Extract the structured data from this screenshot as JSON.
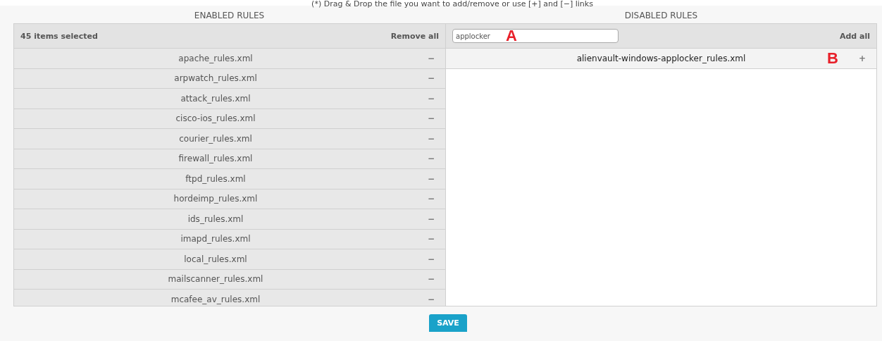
{
  "note": "(*) Drag & Drop the file you want to add/remove or use [+] and [−] links",
  "enabled": {
    "title": "ENABLED RULES",
    "count": "45 items selected",
    "action": "Remove all",
    "items": [
      {
        "name": "apache_rules.xml",
        "control": "−"
      },
      {
        "name": "arpwatch_rules.xml",
        "control": "−"
      },
      {
        "name": "attack_rules.xml",
        "control": "−"
      },
      {
        "name": "cisco-ios_rules.xml",
        "control": "−"
      },
      {
        "name": "courier_rules.xml",
        "control": "−"
      },
      {
        "name": "firewall_rules.xml",
        "control": "−"
      },
      {
        "name": "ftpd_rules.xml",
        "control": "−"
      },
      {
        "name": "hordeimp_rules.xml",
        "control": "−"
      },
      {
        "name": "ids_rules.xml",
        "control": "−"
      },
      {
        "name": "imapd_rules.xml",
        "control": "−"
      },
      {
        "name": "local_rules.xml",
        "control": "−"
      },
      {
        "name": "mailscanner_rules.xml",
        "control": "−"
      },
      {
        "name": "mcafee_av_rules.xml",
        "control": "−"
      }
    ]
  },
  "disabled": {
    "title": "DISABLED RULES",
    "search": {
      "value": "applocker"
    },
    "search_callout": "A",
    "action": "Add all",
    "items": [
      {
        "name": "alienvault-windows-applocker_rules.xml",
        "control": "+",
        "callout": "B"
      }
    ]
  },
  "save": "SAVE"
}
